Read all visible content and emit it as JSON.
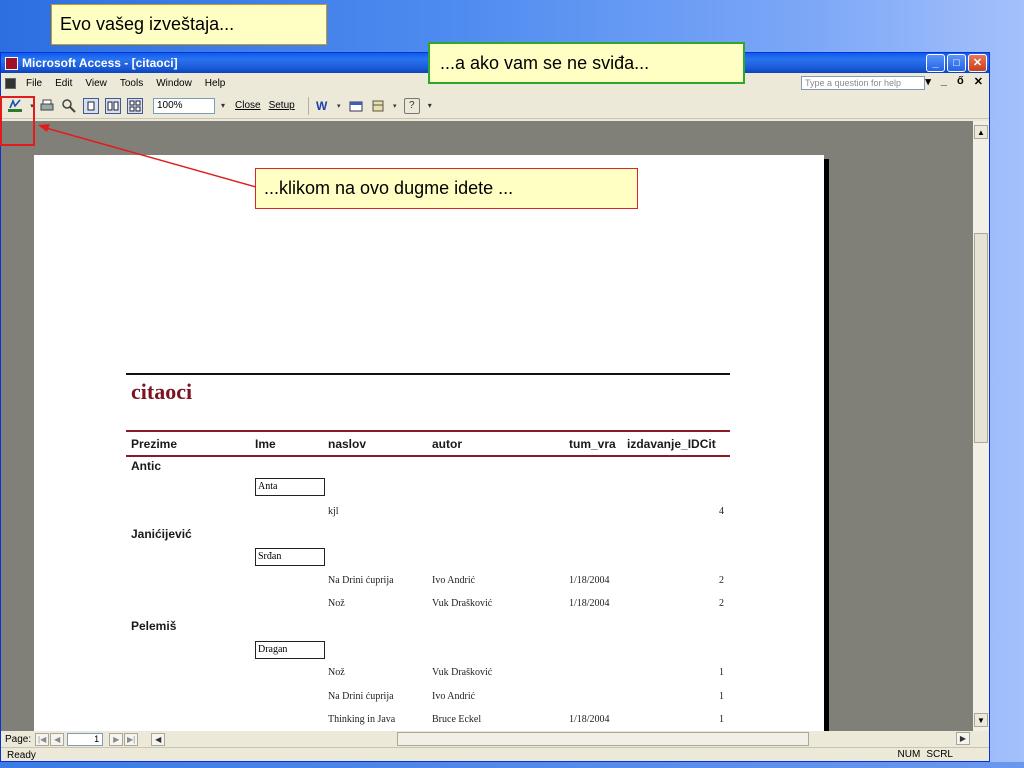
{
  "callouts": {
    "top": "Evo vašeg izveštaja...",
    "right": "...a ako vam se ne sviđa...",
    "middle": "...klikom na ovo dugme  idete ..."
  },
  "window": {
    "title": "Microsoft Access - [citaoci]",
    "buttons": {
      "minimize": "_",
      "maximize": "□",
      "close": "✕"
    }
  },
  "menu": {
    "items": [
      "File",
      "Edit",
      "View",
      "Tools",
      "Window",
      "Help"
    ],
    "help_placeholder": "Type a question for help",
    "doc_controls": [
      "▾",
      "_",
      "ő",
      "✕"
    ]
  },
  "toolbar": {
    "zoom": "100%",
    "close_label": "Close",
    "setup_label": "Setup"
  },
  "report": {
    "title": "citaoci",
    "columns": [
      "Prezime",
      "Ime",
      "naslov",
      "autor",
      "tum_vra",
      "izdavanje_IDCit"
    ],
    "groups": [
      {
        "prezime": "Antic",
        "ime": "Anta",
        "rows": [
          {
            "naslov": "kjl",
            "autor": "",
            "datum": "",
            "id": "4"
          }
        ]
      },
      {
        "prezime": "Janićijević",
        "ime": "Srđan",
        "rows": [
          {
            "naslov": "Na Drini ćuprija",
            "autor": "Ivo Andrić",
            "datum": "1/18/2004",
            "id": "2"
          },
          {
            "naslov": "Nož",
            "autor": "Vuk Drašković",
            "datum": "1/18/2004",
            "id": "2"
          }
        ]
      },
      {
        "prezime": "Pelemiš",
        "ime": "Dragan",
        "rows": [
          {
            "naslov": "Nož",
            "autor": "Vuk Drašković",
            "datum": "",
            "id": "1"
          },
          {
            "naslov": "Na Drini ćuprija",
            "autor": "Ivo Andrić",
            "datum": "",
            "id": "1"
          },
          {
            "naslov": "Thinking in Java",
            "autor": "Bruce Eckel",
            "datum": "1/18/2004",
            "id": "1"
          }
        ]
      }
    ]
  },
  "navigation": {
    "page_label": "Page:",
    "page_number": "1"
  },
  "status": {
    "text": "Ready",
    "num": "NUM",
    "scrl": "SCRL"
  },
  "colors": {
    "title_bar": "#0a5bf0",
    "report_title": "#7a1322",
    "callout_fill": "#ffffc4",
    "highlight": "#e21c1c"
  }
}
